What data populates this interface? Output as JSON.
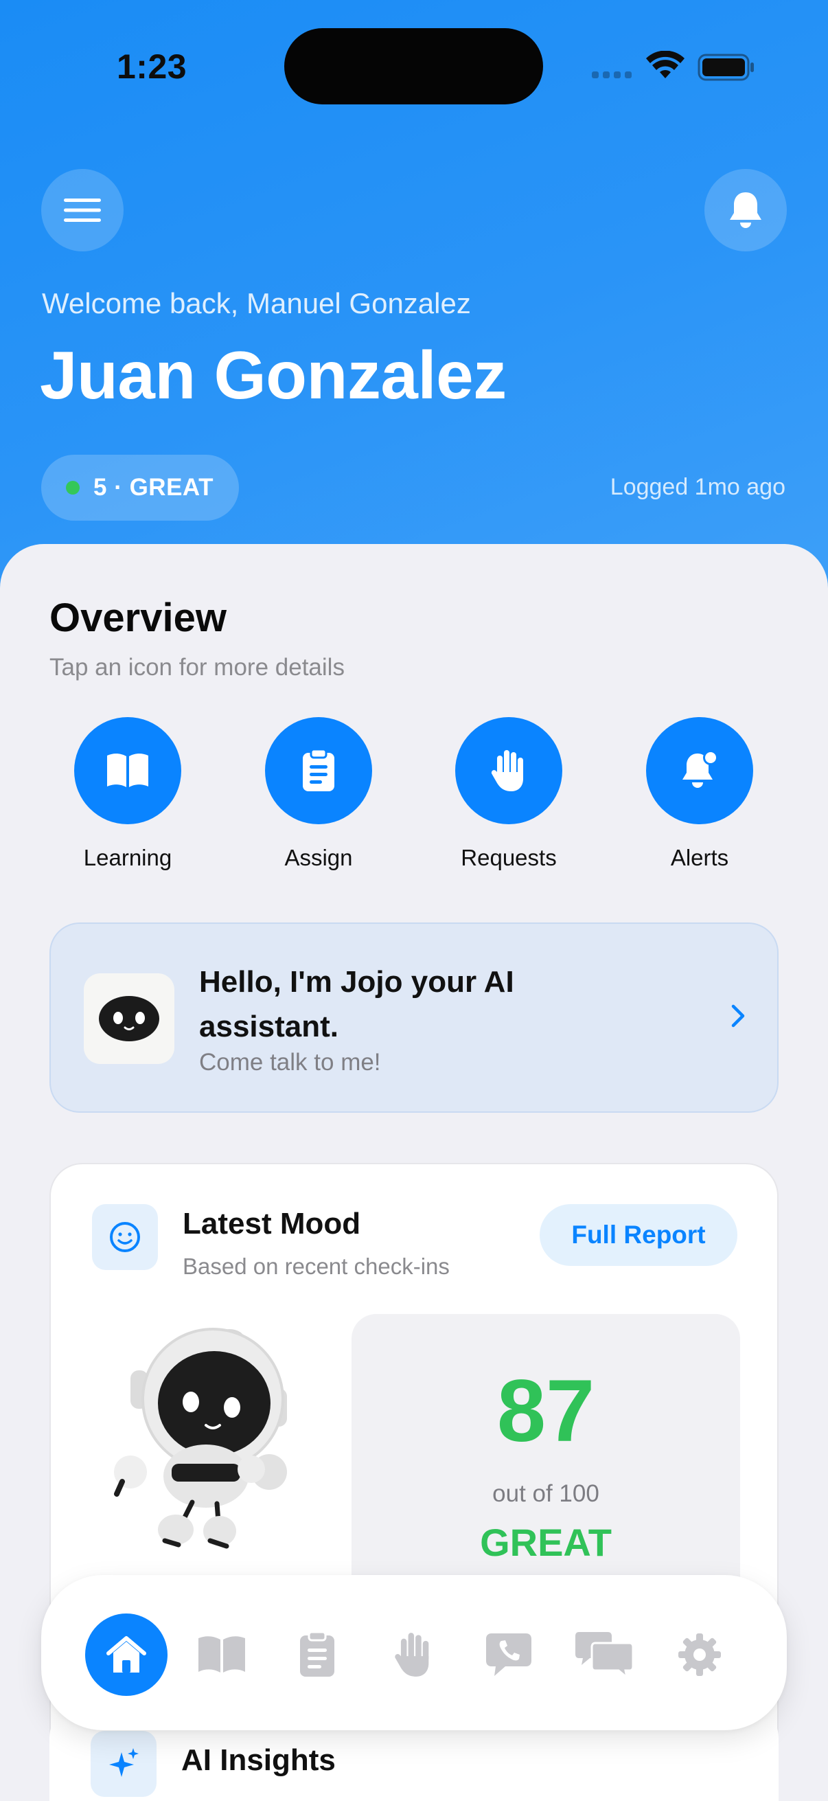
{
  "status_bar": {
    "time": "1:23"
  },
  "header": {
    "welcome": "Welcome back, Manuel Gonzalez",
    "name": "Juan Gonzalez",
    "status_pill": "5 · GREAT",
    "logged": "Logged 1mo ago",
    "colors": {
      "hero": "#1a8cf5",
      "status_dot": "#34c759"
    }
  },
  "overview": {
    "title": "Overview",
    "subtitle": "Tap an icon for more details",
    "items": [
      {
        "label": "Learning",
        "icon": "book-icon"
      },
      {
        "label": "Assign",
        "icon": "clipboard-icon"
      },
      {
        "label": "Requests",
        "icon": "hand-icon"
      },
      {
        "label": "Alerts",
        "icon": "bell-badge-icon"
      }
    ]
  },
  "assistant": {
    "title": "Hello, I'm Jojo your AI assistant.",
    "subtitle": "Come talk to me!"
  },
  "mood": {
    "title": "Latest Mood",
    "subtitle": "Based on recent check-ins",
    "report_button": "Full Report",
    "score": "87",
    "score_caption": "out of 100",
    "score_word": "GREAT",
    "accent": "#30c258"
  },
  "ai_insights": {
    "title": "AI Insights"
  },
  "tab_bar": {
    "tabs": [
      {
        "icon": "home-icon",
        "active": true
      },
      {
        "icon": "book-icon",
        "active": false
      },
      {
        "icon": "clipboard-icon",
        "active": false
      },
      {
        "icon": "hand-icon",
        "active": false
      },
      {
        "icon": "phone-bubble-icon",
        "active": false
      },
      {
        "icon": "chat-bubbles-icon",
        "active": false
      },
      {
        "icon": "gear-icon",
        "active": false
      }
    ],
    "active_color": "#0a84ff"
  }
}
